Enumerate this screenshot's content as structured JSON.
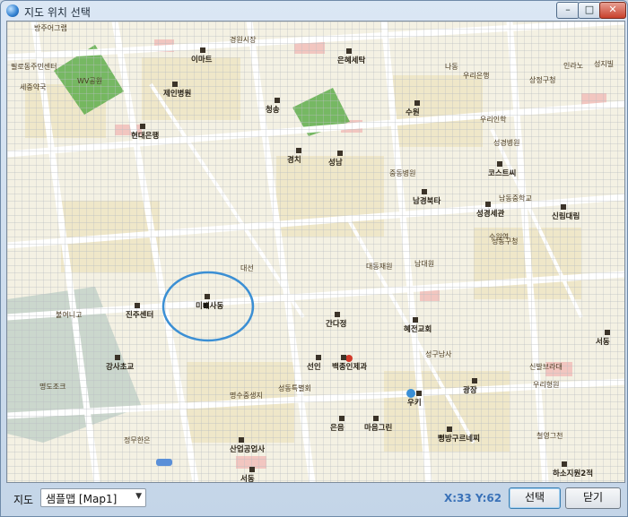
{
  "window": {
    "title": "지도 위치 선택",
    "controls": {
      "minimize": "–",
      "maximize": "□",
      "close": "✕"
    }
  },
  "map": {
    "icons": {
      "marker": "selection-marker-icon",
      "pin": "place-pin-icon",
      "circle": "selection-circle"
    },
    "labels": [
      {
        "text": "방주어그랩",
        "bold": false
      },
      {
        "text": "필로동주민센터",
        "bold": false
      },
      {
        "text": "세중약국",
        "bold": false
      },
      {
        "text": "WV공원",
        "bold": false
      },
      {
        "text": "이마트",
        "bold": true
      },
      {
        "text": "경원시장",
        "bold": false
      },
      {
        "text": "제인병원",
        "bold": true
      },
      {
        "text": "은혜세탁",
        "bold": true
      },
      {
        "text": "나동",
        "bold": false
      },
      {
        "text": "우리은행",
        "bold": false
      },
      {
        "text": "성지빌",
        "bold": false
      },
      {
        "text": "현대은행",
        "bold": true
      },
      {
        "text": "청송",
        "bold": true
      },
      {
        "text": "수원",
        "bold": true
      },
      {
        "text": "우리인학",
        "bold": false
      },
      {
        "text": "경치",
        "bold": true
      },
      {
        "text": "성남",
        "bold": true
      },
      {
        "text": "중동병원",
        "bold": false
      },
      {
        "text": "코스트씨",
        "bold": true
      },
      {
        "text": "성경세관",
        "bold": true
      },
      {
        "text": "수원역",
        "bold": false
      },
      {
        "text": "남경북타",
        "bold": true
      },
      {
        "text": "신림대림",
        "bold": true
      },
      {
        "text": "성동구청",
        "bold": false
      },
      {
        "text": "남대원",
        "bold": false
      },
      {
        "text": "진주센터",
        "bold": true
      },
      {
        "text": "강사초교",
        "bold": true
      },
      {
        "text": "미대사동",
        "bold": true
      },
      {
        "text": "간다정",
        "bold": true
      },
      {
        "text": "혜전교회",
        "bold": true
      },
      {
        "text": "서동",
        "bold": true
      },
      {
        "text": "선인",
        "bold": true
      },
      {
        "text": "백종인제과",
        "bold": true
      },
      {
        "text": "우키",
        "bold": true
      },
      {
        "text": "광장",
        "bold": true
      },
      {
        "text": "은음",
        "bold": true
      },
      {
        "text": "마음그린",
        "bold": true
      },
      {
        "text": "뻥방구르네찌",
        "bold": true
      },
      {
        "text": "산업공업사",
        "bold": true
      },
      {
        "text": "서동",
        "bold": true
      },
      {
        "text": "하소지원2적",
        "bold": true
      },
      {
        "text": "명수중생지",
        "bold": false
      },
      {
        "text": "성동특별회",
        "bold": false
      },
      {
        "text": "신발브라대",
        "bold": false
      },
      {
        "text": "성구남사",
        "bold": false
      },
      {
        "text": "철영그천",
        "bold": false
      },
      {
        "text": "남동중학교",
        "bold": false
      },
      {
        "text": "인라노",
        "bold": false
      },
      {
        "text": "상정구청",
        "bold": false
      },
      {
        "text": "대선",
        "bold": false
      },
      {
        "text": "대동재원",
        "bold": false
      },
      {
        "text": "성경병원",
        "bold": false
      },
      {
        "text": "우리형원",
        "bold": false
      },
      {
        "text": "명도조크",
        "bold": false
      },
      {
        "text": "불여니고",
        "bold": false
      },
      {
        "text": "정무한은",
        "bold": false
      }
    ]
  },
  "bottom": {
    "map_label": "지도",
    "map_select": {
      "value": "샘플맵 [Map1]"
    },
    "coordinates": "X:33 Y:62",
    "select_button": "선택",
    "close_button": "닫기"
  },
  "colors": {
    "map_background": "#f4f1e3",
    "grid": "#b9bdc2",
    "road": "#ffffff",
    "park": "#5fae4c",
    "selection_circle": "#3b8fd4",
    "coords_text": "#3a72b8"
  }
}
